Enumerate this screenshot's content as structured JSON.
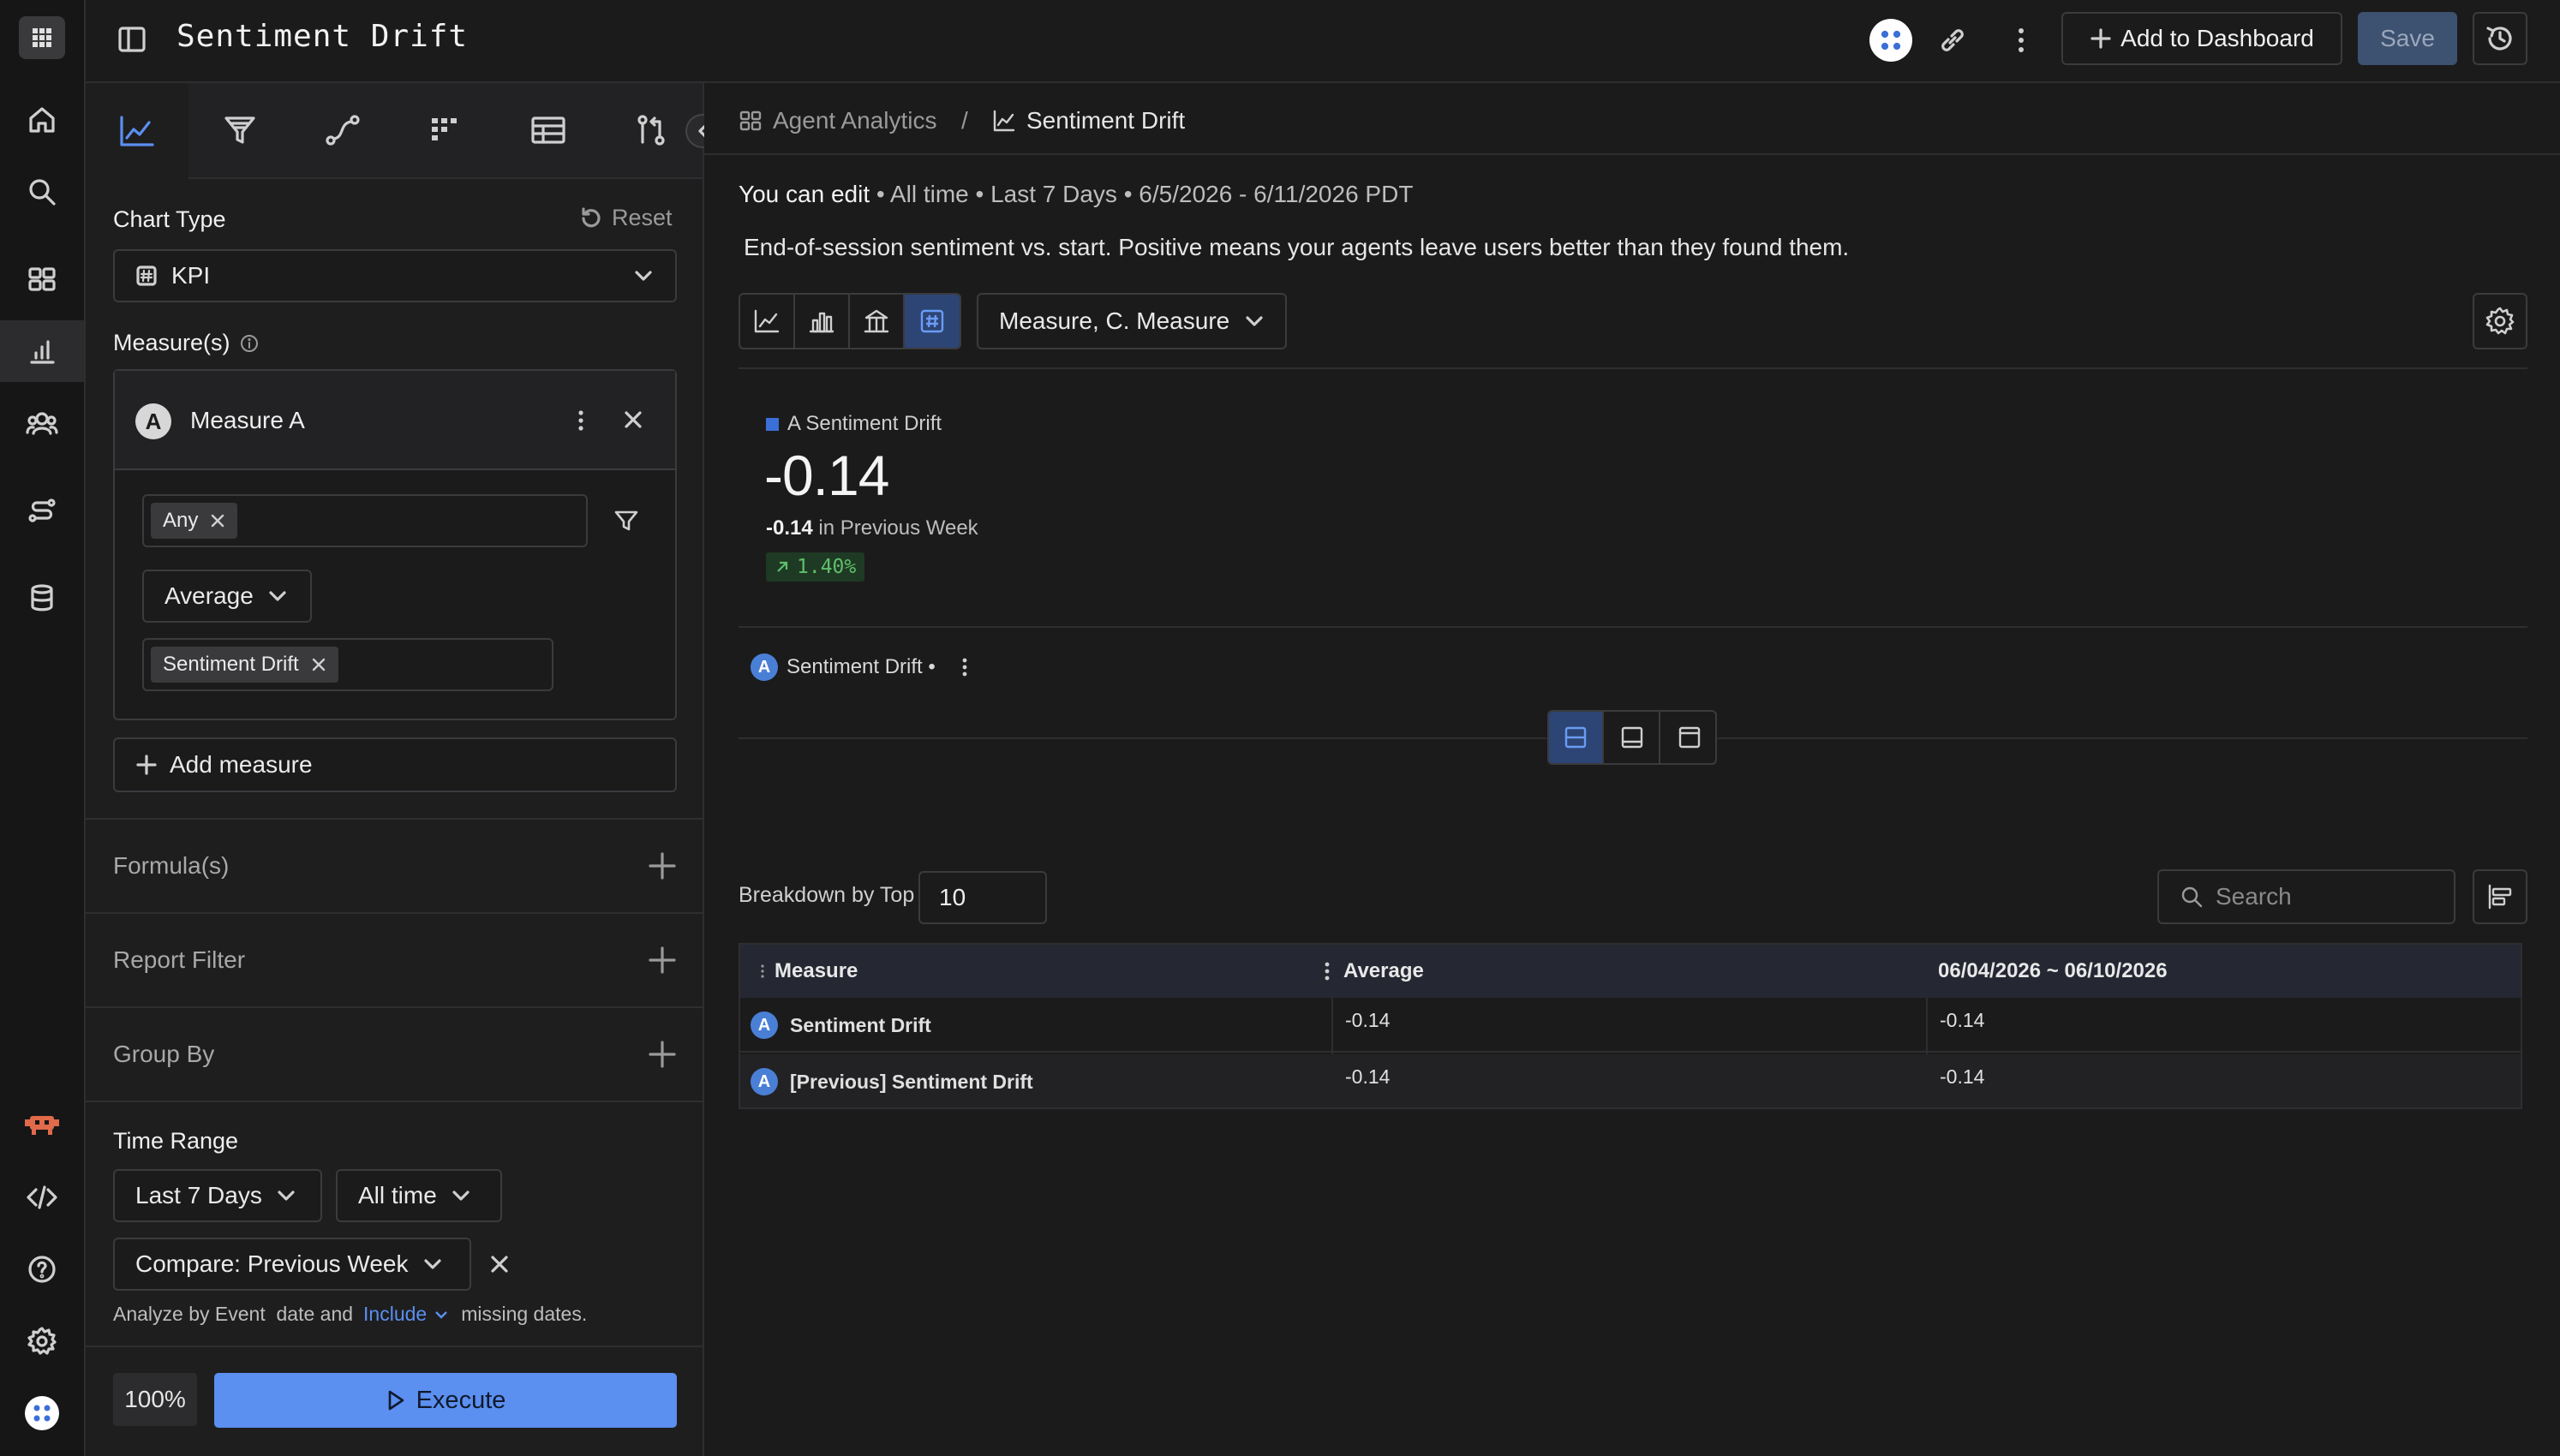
{
  "app": {
    "title": "Sentiment Drift"
  },
  "header": {
    "add_dashboard": "Add to Dashboard",
    "save": "Save"
  },
  "panel": {
    "chart_type_label": "Chart Type",
    "reset": "Reset",
    "chart_type_value": "KPI",
    "measures_label": "Measure(s)",
    "measure_name": "Measure A",
    "measure_letter": "A",
    "filter_chip": "Any",
    "aggregation": "Average",
    "event_chip": "Sentiment Drift",
    "add_measure": "Add measure",
    "formulas": "Formula(s)",
    "report_filter": "Report Filter",
    "group_by": "Group By",
    "time_range_label": "Time Range",
    "range_value": "Last 7 Days",
    "range_scope": "All time",
    "compare": "Compare: Previous Week",
    "analyze_prefix": "Analyze by Event  date and",
    "analyze_link": "Include",
    "analyze_suffix": "missing dates.",
    "zoom": "100%",
    "execute": "Execute"
  },
  "breadcrumb": {
    "parent": "Agent Analytics",
    "sep": "/",
    "current": "Sentiment Drift"
  },
  "info": {
    "line_bold": "You can edit",
    "line_rest": " • All time • Last 7 Days • 6/5/2026 - 6/11/2026 PDT",
    "description": "End-of-session sentiment vs. start. Positive means your agents leave users better than they found them.",
    "measure_select": "Measure, C. Measure"
  },
  "kpi": {
    "legend": "A Sentiment Drift",
    "value": "-0.14",
    "prev_value": "-0.14",
    "prev_text": " in Previous Week",
    "change": "1.40%",
    "color": "#3b6fd8",
    "change_color": "#5fbf6a"
  },
  "series_chip": {
    "letter": "A",
    "label": "Sentiment Drift •"
  },
  "table": {
    "breakdown_label": "Breakdown by Top",
    "breakdown_value": "10",
    "search_placeholder": "Search",
    "headers": [
      "Measure",
      "Average",
      "06/04/2026 ~ 06/10/2026"
    ],
    "rows": [
      {
        "letter": "A",
        "name": "Sentiment Drift",
        "avg": "-0.14",
        "period": "-0.14"
      },
      {
        "letter": "A",
        "name": "[Previous] Sentiment Drift",
        "avg": "-0.14",
        "period": "-0.14"
      }
    ]
  }
}
